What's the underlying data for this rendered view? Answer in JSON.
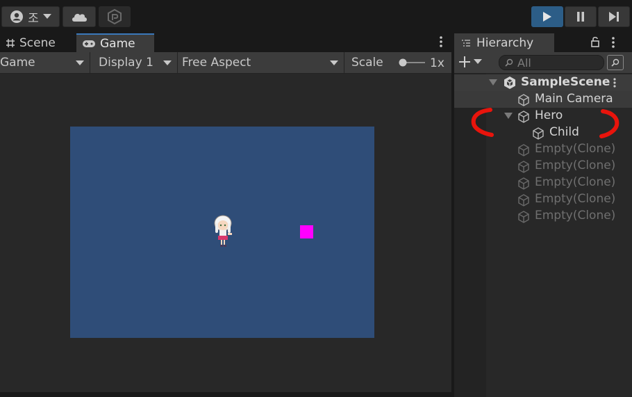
{
  "toolbar": {
    "account_label": "조",
    "icons": [
      "account-icon",
      "cloud-icon",
      "collab-icon",
      "play-icon",
      "pause-icon",
      "step-icon"
    ],
    "accent_color": "#2c5d87"
  },
  "game_panel": {
    "tabs": [
      {
        "label": "Scene",
        "icon": "hash-icon",
        "active": false
      },
      {
        "label": "Game",
        "icon": "gamepad-icon",
        "active": true
      }
    ],
    "bar": {
      "view_dropdown": "Game",
      "display_dropdown": "Display 1",
      "aspect_dropdown": "Free Aspect",
      "scale_label": "Scale",
      "scale_value": "1x"
    },
    "view_background": "#2f4d78",
    "square_color": "#ff00ff"
  },
  "hierarchy": {
    "tab_label": "Hierarchy",
    "search_placeholder": "All",
    "scene_name": "SampleScene",
    "items": [
      {
        "name": "Main Camera",
        "disabled": false
      },
      {
        "name": "Hero",
        "disabled": false,
        "expanded": true
      },
      {
        "name": "Child",
        "disabled": false
      },
      {
        "name": "Empty(Clone)",
        "disabled": true
      },
      {
        "name": "Empty(Clone)",
        "disabled": true
      },
      {
        "name": "Empty(Clone)",
        "disabled": true
      },
      {
        "name": "Empty(Clone)",
        "disabled": true
      },
      {
        "name": "Empty(Clone)",
        "disabled": true
      }
    ]
  },
  "annotation_color": "#e8140c"
}
